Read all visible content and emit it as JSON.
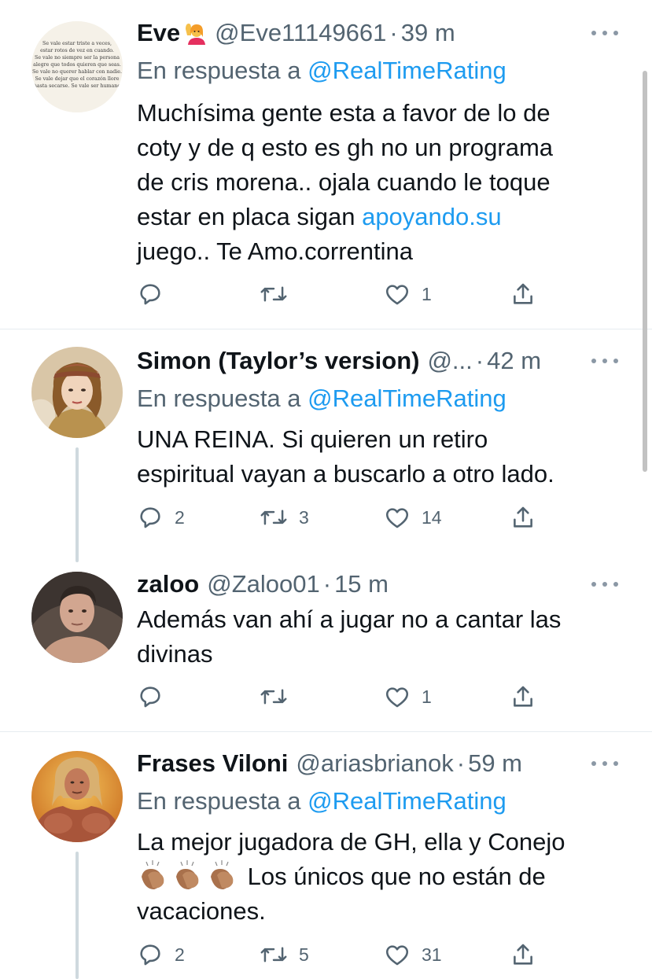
{
  "tweets": [
    {
      "name": "Eve",
      "handle": "@Eve11149661",
      "separator": "·",
      "time": "39 m",
      "reply_prefix": "En respuesta a ",
      "reply_mention": "@RealTimeRating",
      "text_lines": [
        "Muchísima gente esta a favor de lo de",
        "coty y de q esto es gh no un programa",
        "de cris morena.. ojala cuando le toque",
        "estar en placa sigan ",
        "juego.. Te Amo.correntina"
      ],
      "text_link": "apoyando.su",
      "avatar_text": [
        "Se vale estar triste a veces,",
        "estar rotos de vez en cuando.",
        "Se vale no siempre ser la persona",
        "alegre que todos quieren que seas.",
        "Se vale no querer hablar con nadie.",
        "Se vale dejar que el corazón llore",
        "hasta secarse. Se vale ser humano"
      ],
      "replies": "",
      "retweets": "",
      "likes": "1"
    },
    {
      "name": "Simon (Taylor’s version)",
      "handle": "@...",
      "separator": "·",
      "time": "42 m",
      "reply_prefix": "En respuesta a ",
      "reply_mention": "@RealTimeRating",
      "text_lines": [
        "UNA REINA. Si quieren un retiro",
        "espiritual vayan a buscarlo a otro lado."
      ],
      "replies": "2",
      "retweets": "3",
      "likes": "14"
    },
    {
      "name": "zaloo",
      "handle": "@Zaloo01",
      "separator": "·",
      "time": "15 m",
      "text_lines": [
        "Además van ahí a jugar no a cantar las",
        "divinas"
      ],
      "replies": "",
      "retweets": "",
      "likes": "1"
    },
    {
      "name": "Frases Viloni",
      "handle": "@ariasbrianok",
      "separator": "·",
      "time": "59 m",
      "reply_prefix": "En respuesta a ",
      "reply_mention": "@RealTimeRating",
      "text_lines": [
        "La mejor jugadora de GH, ella y Conejo",
        " Los únicos que no están de",
        "vacaciones."
      ],
      "replies": "2",
      "retweets": "5",
      "likes": "31"
    }
  ],
  "icons": {
    "reply": "reply-icon",
    "retweet": "retweet-icon",
    "like": "heart-icon",
    "share": "share-icon",
    "more": "more-icon"
  },
  "colors": {
    "link": "#1d9bf0",
    "secondary_text": "#536471",
    "divider": "#e6ecf0",
    "thread_line": "#cfd9de"
  }
}
